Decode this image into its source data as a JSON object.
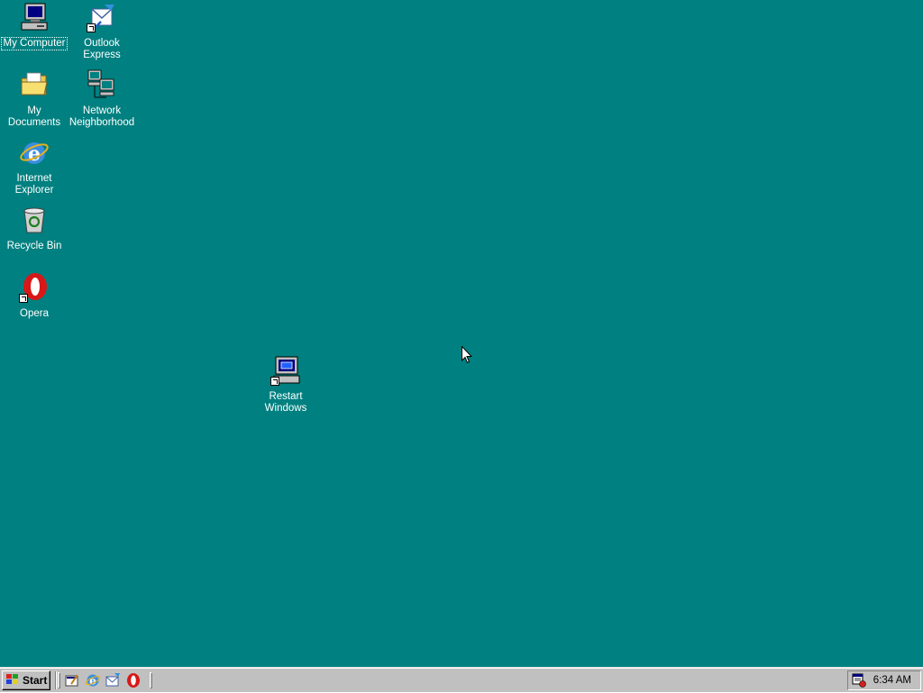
{
  "desktop": {
    "background": "#008080",
    "icons": [
      {
        "label": "My Computer",
        "icon": "my-computer-icon"
      },
      {
        "label": "Outlook\nExpress",
        "icon": "outlook-express-icon"
      },
      {
        "label": "My Documents",
        "icon": "my-documents-icon"
      },
      {
        "label": "Network\nNeighborhood",
        "icon": "network-neighborhood-icon"
      },
      {
        "label": "Internet\nExplorer",
        "icon": "internet-explorer-icon"
      },
      {
        "label": "Recycle Bin",
        "icon": "recycle-bin-icon"
      },
      {
        "label": "Opera",
        "icon": "opera-icon"
      },
      {
        "label": "Restart\nWindows",
        "icon": "restart-windows-icon"
      }
    ]
  },
  "taskbar": {
    "start_label": "Start",
    "quick_launch": [
      {
        "icon": "show-desktop-icon"
      },
      {
        "icon": "internet-explorer-icon"
      },
      {
        "icon": "outlook-express-icon"
      },
      {
        "icon": "opera-icon"
      }
    ],
    "tray": {
      "icon": "scheduler-icon",
      "clock": "6:34 AM"
    }
  }
}
